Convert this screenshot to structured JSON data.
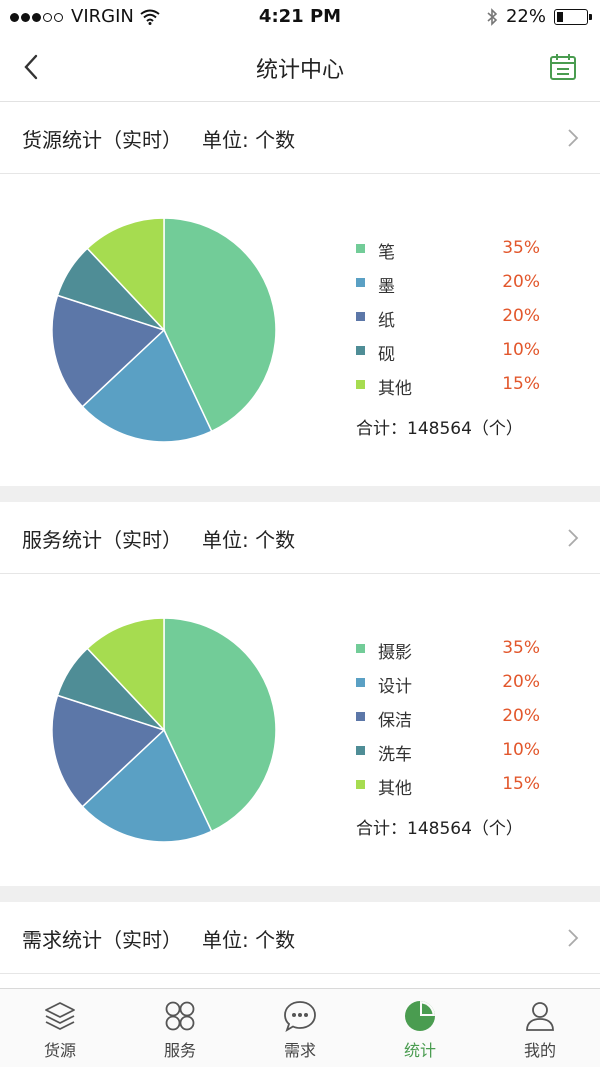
{
  "status_bar": {
    "carrier": "VIRGIN",
    "time": "4:21 PM",
    "battery": "22%",
    "battery_level": 0.22
  },
  "nav": {
    "title": "统计中心",
    "back_icon": "chevron-left-icon",
    "calendar_icon": "calendar-icon"
  },
  "colors": {
    "accent": "#4a9c50",
    "percent": "#e2572c"
  },
  "sections": [
    {
      "title": "货源统计（实时）",
      "unit": "单位: 个数",
      "total": "合计：148564（个）",
      "items": [
        {
          "label": "笔",
          "pct": "35%",
          "value": 0.43,
          "color": "#72cc98"
        },
        {
          "label": "墨",
          "pct": "20%",
          "value": 0.2,
          "color": "#5aa0c4"
        },
        {
          "label": "纸",
          "pct": "20%",
          "value": 0.17,
          "color": "#5c77a8"
        },
        {
          "label": "砚",
          "pct": "10%",
          "value": 0.08,
          "color": "#4f8d96"
        },
        {
          "label": "其他",
          "pct": "15%",
          "value": 0.12,
          "color": "#a6dc50"
        }
      ]
    },
    {
      "title": "服务统计（实时）",
      "unit": "单位: 个数",
      "total": "合计：148564（个）",
      "items": [
        {
          "label": "摄影",
          "pct": "35%",
          "value": 0.43,
          "color": "#72cc98"
        },
        {
          "label": "设计",
          "pct": "20%",
          "value": 0.2,
          "color": "#5aa0c4"
        },
        {
          "label": "保洁",
          "pct": "20%",
          "value": 0.17,
          "color": "#5c77a8"
        },
        {
          "label": "洗车",
          "pct": "10%",
          "value": 0.08,
          "color": "#4f8d96"
        },
        {
          "label": "其他",
          "pct": "15%",
          "value": 0.12,
          "color": "#a6dc50"
        }
      ]
    },
    {
      "title": "需求统计（实时）",
      "unit": "单位: 个数"
    }
  ],
  "tabs": [
    {
      "label": "货源",
      "icon": "layers-icon",
      "active": false
    },
    {
      "label": "服务",
      "icon": "grid-circles-icon",
      "active": false
    },
    {
      "label": "需求",
      "icon": "chat-bubble-icon",
      "active": false
    },
    {
      "label": "统计",
      "icon": "pie-chart-icon",
      "active": true
    },
    {
      "label": "我的",
      "icon": "user-icon",
      "active": false
    }
  ]
}
